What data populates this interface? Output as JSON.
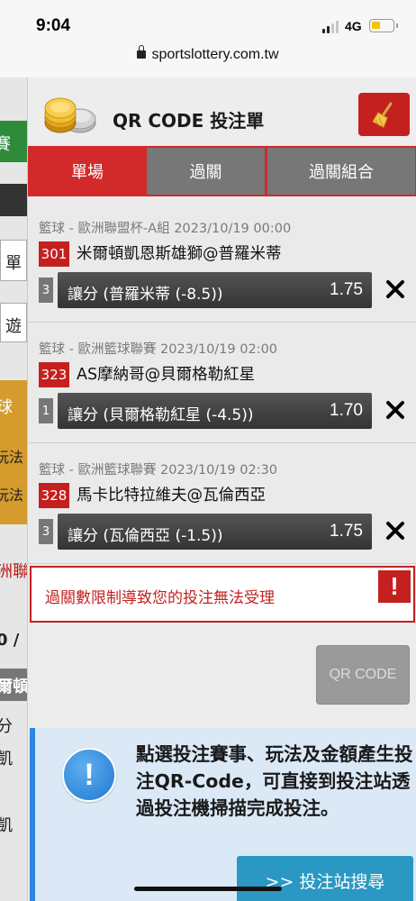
{
  "status_bar": {
    "time": "9:04",
    "network": "4G"
  },
  "browser": {
    "url": "sportslottery.com.tw"
  },
  "background_page": {
    "fragments": [
      "賽",
      "單",
      "遊",
      "球",
      "玩法",
      "玩法",
      "洲聯",
      "0 /",
      "爾頓",
      "分",
      "凱",
      "凱"
    ]
  },
  "modal": {
    "title": "QR CODE 投注單",
    "tabs": [
      {
        "label": "單場"
      },
      {
        "label": "過關"
      },
      {
        "label": "過關組合"
      }
    ],
    "bets": [
      {
        "meta": "籃球 - 歐洲聯盟杯-A組 2023/10/19 00:00",
        "number": "301",
        "match": "米爾頓凱恩斯雄獅@普羅米蒂",
        "selection_number": "3",
        "bet": "讓分 (普羅米蒂 (-8.5))",
        "odds": "1.75"
      },
      {
        "meta": "籃球 - 歐洲籃球聯賽 2023/10/19 02:00",
        "number": "323",
        "match": "AS摩納哥@貝爾格勒紅星",
        "selection_number": "1",
        "bet": "讓分 (貝爾格勒紅星 (-4.5))",
        "odds": "1.70"
      },
      {
        "meta": "籃球 - 歐洲籃球聯賽 2023/10/19 02:30",
        "number": "328",
        "match": "馬卡比特拉維夫@瓦倫西亞",
        "selection_number": "3",
        "bet": "讓分 (瓦倫西亞 (-1.5))",
        "odds": "1.75"
      }
    ],
    "error_message": "過關數限制導致您的投注無法受理",
    "error_icon": "!",
    "qr_button": "QR CODE",
    "info_icon": "!",
    "info_text": "點選投注賽事、玩法及金額產生投注QR-Code，可直接到投注站透過投注機掃描完成投注。",
    "search_button": ">> 投注站搜尋"
  },
  "colors": {
    "accent_red": "#d22a2a",
    "tab_inactive": "#777777",
    "info_blue": "#2e86de",
    "search_button": "#2a98c2"
  }
}
